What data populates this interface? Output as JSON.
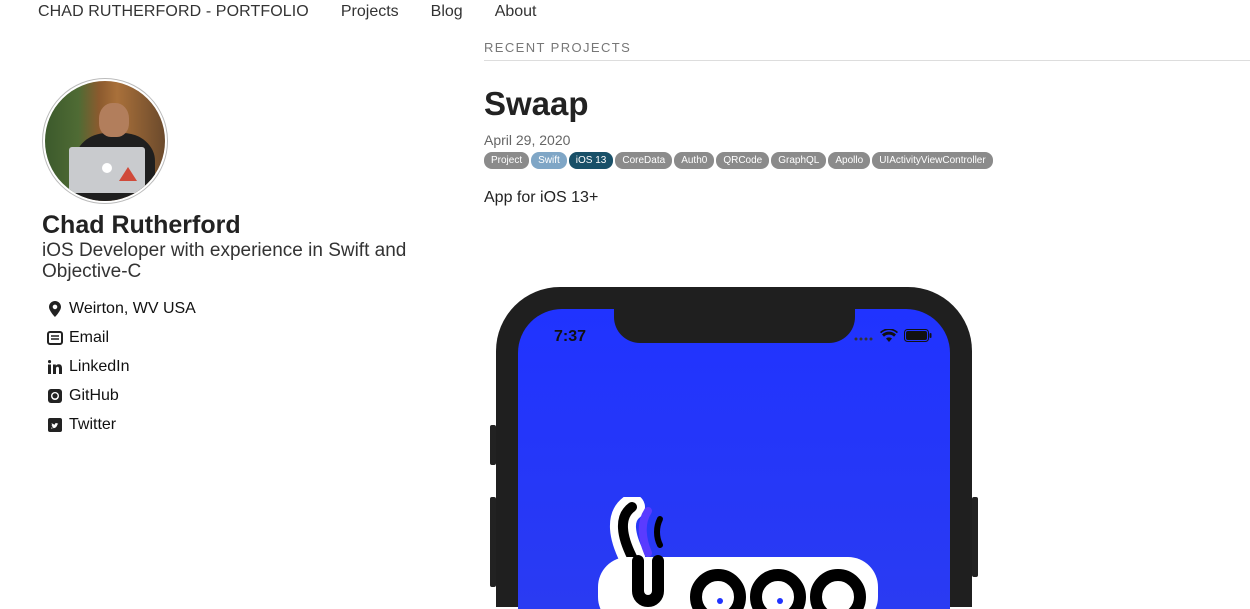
{
  "nav": {
    "brand": "CHAD RUTHERFORD - PORTFOLIO",
    "items": [
      "Projects",
      "Blog",
      "About"
    ]
  },
  "profile": {
    "name": "Chad Rutherford",
    "bio": "iOS Developer with experience in Swift and Objective-C",
    "links": [
      {
        "icon": "location-pin-icon",
        "label": "Weirton, WV USA"
      },
      {
        "icon": "email-icon",
        "label": "Email"
      },
      {
        "icon": "linkedin-icon",
        "label": "LinkedIn"
      },
      {
        "icon": "github-icon",
        "label": "GitHub"
      },
      {
        "icon": "twitter-icon",
        "label": "Twitter"
      }
    ]
  },
  "main": {
    "section_title": "RECENT PROJECTS",
    "post": {
      "title": "Swaap",
      "date": "April 29, 2020",
      "tags": [
        "Project",
        "Swift",
        "iOS 13",
        "CoreData",
        "Auth0",
        "QRCode",
        "GraphQL",
        "Apollo",
        "UIActivityViewController"
      ],
      "summary": "App for iOS 13+"
    },
    "phone": {
      "time": "7:37"
    }
  },
  "colors": {
    "tag_default": "#8b8b8b",
    "tag_swift": "#7fa6c6",
    "tag_ios": "#185068",
    "screen_blue": "#2033ff"
  }
}
